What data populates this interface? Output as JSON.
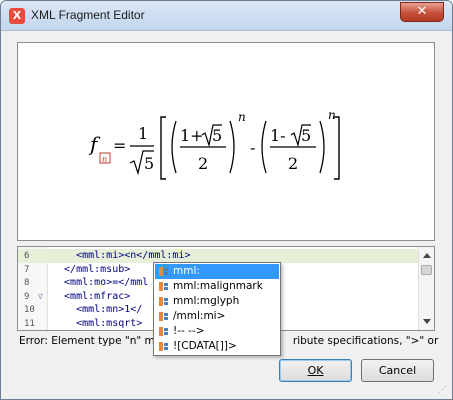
{
  "window": {
    "title": "XML Fragment Editor",
    "close_label": "✕",
    "app_icon": "X"
  },
  "formula": {
    "f": "f",
    "sub": "n",
    "eq": "=",
    "one": "1",
    "five": "5",
    "two": "2",
    "plus_term": "1+",
    "minus_term": "1-",
    "exp": "n",
    "minus": "-"
  },
  "editor": {
    "lines": [
      {
        "num": "6",
        "code": "    <mml:mi><n</mml:mi>",
        "current": true,
        "fold": ""
      },
      {
        "num": "7",
        "code": "  </mml:msub>",
        "current": false,
        "fold": ""
      },
      {
        "num": "8",
        "code": "  <mml:mo>=</mml",
        "current": false,
        "fold": ""
      },
      {
        "num": "9",
        "code": "  <mml:mfrac>",
        "current": false,
        "fold": "▽"
      },
      {
        "num": "10",
        "code": "    <mml:mn>1</",
        "current": false,
        "fold": ""
      },
      {
        "num": "11",
        "code": "    <mml:msqrt>",
        "current": false,
        "fold": ""
      }
    ]
  },
  "completion": {
    "items": [
      "mml:",
      "mml:malignmark",
      "mml:mglyph",
      "/mml:mi>",
      "!-- -->",
      "![CDATA[]]>"
    ],
    "selected_index": 0
  },
  "error_text": "Error: Element type \"n\" mus",
  "error_text_tail": "ribute specifications, \">\" or \"/>\".",
  "buttons": {
    "ok": "OK",
    "cancel": "Cancel"
  }
}
